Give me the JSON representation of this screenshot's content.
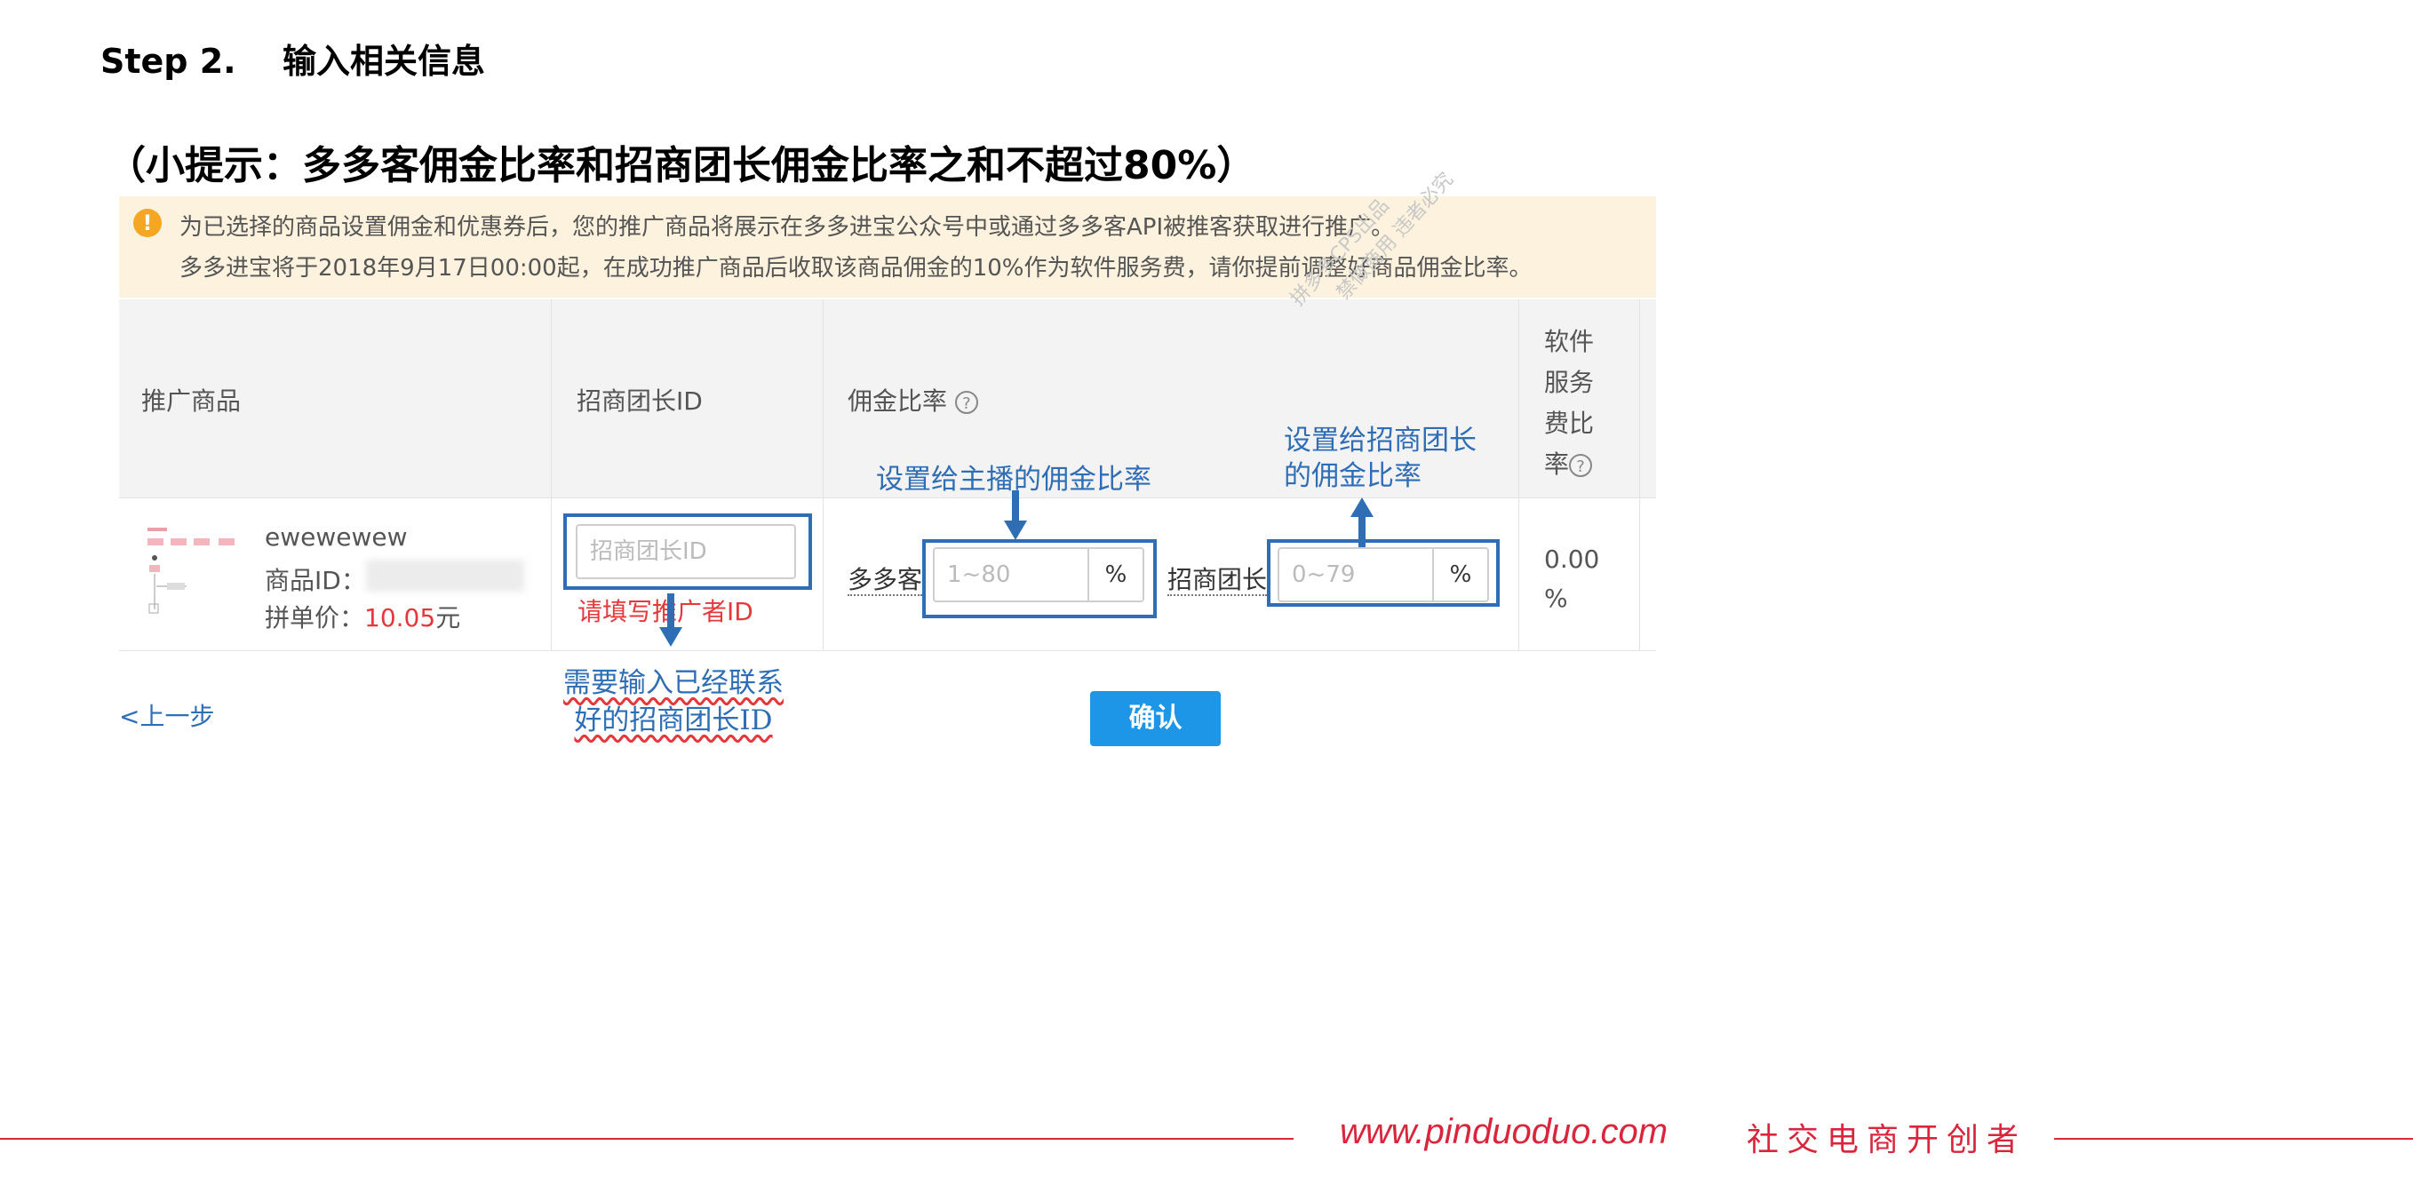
{
  "header": {
    "step": "Step 2.",
    "step_title": "输入相关信息",
    "tip": "（小提示：多多客佣金比率和招商团长佣金比率之和不超过80%）"
  },
  "notice": {
    "icon": "warning-icon",
    "line1": "为已选择的商品设置佣金和优惠券后，您的推广商品将展示在多多进宝公众号中或通过多多客API被推客获取进行推广。",
    "line2": "多多进宝将于2018年9月17日00:00起，在成功推广商品后收取该商品佣金的10%作为软件服务费，请你提前调整好商品佣金比率。",
    "bg_color": "#fdf2dd"
  },
  "table": {
    "columns": [
      "推广商品",
      "招商团长ID",
      "佣金比率",
      "软件服务费比率"
    ],
    "column_fee_lines": [
      "软件",
      "服务",
      "费比",
      "率"
    ],
    "row": {
      "product_name": "ewewewew",
      "product_id_label": "商品ID：",
      "price_label": "拼单价：",
      "price_value": "10.05",
      "price_unit": "元",
      "leader_id_placeholder": "招商团长ID",
      "leader_id_error": "请填写推广者ID",
      "duoduoke_label": "多多客",
      "duoduoke_placeholder": "1~80",
      "leader_label": "招商团长",
      "leader_placeholder": "0~79",
      "unit": "%",
      "fee_value": "0.00",
      "fee_unit": "%"
    }
  },
  "annotations": {
    "anchor_rate": "设置给主播的佣金比率",
    "leader_rate_line1": "设置给招商团长",
    "leader_rate_line2": "的佣金比率",
    "need_id_line1": "需要输入已经联系",
    "need_id_line2": "好的招商团长ID",
    "color": "#2f6eb5"
  },
  "watermark": {
    "line1": "拼多多CPS出品",
    "line2": "禁做商用 违者必究"
  },
  "actions": {
    "prev": "<上一步",
    "confirm": "确认"
  },
  "footer": {
    "url": "www.pinduoduo.com",
    "slogan": "社交电商开创者",
    "color": "#d9263c"
  }
}
